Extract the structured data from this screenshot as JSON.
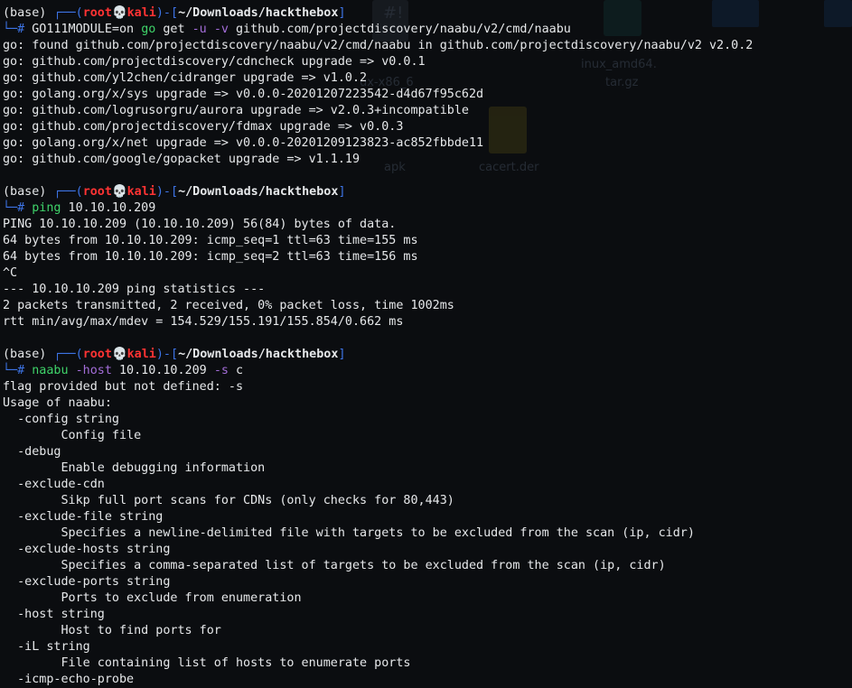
{
  "desktop": {
    "icons": [
      {
        "label": "#!",
        "kind": "script"
      },
      {
        "label": "inux_amd64.",
        "kind": "archive"
      },
      {
        "label": "tar.gz",
        "kind": "archive"
      },
      {
        "label": "ux-x86_6",
        "kind": "file"
      },
      {
        "label": "apk",
        "kind": "file"
      },
      {
        "label": "cacert.der",
        "kind": "certificate"
      }
    ]
  },
  "prompt": {
    "env": "(base)",
    "user": "root",
    "skull": "💀",
    "host": "kali",
    "cwd": "~/Downloads/hackthebox",
    "top_connector": "┌──(",
    "bottom_connector": "└─#",
    "mid_sep": ")-[",
    "close": "]"
  },
  "sessions": [
    {
      "command": {
        "pre": "GO111MODULE=on ",
        "bin": "go",
        "args": " get ",
        "flag1": "-u",
        "space": " ",
        "flag2": "-v",
        "rest": " github.com/projectdiscovery/naabu/v2/cmd/naabu"
      },
      "output": [
        "go: found github.com/projectdiscovery/naabu/v2/cmd/naabu in github.com/projectdiscovery/naabu/v2 v2.0.2",
        "go: github.com/projectdiscovery/cdncheck upgrade => v0.0.1",
        "go: github.com/yl2chen/cidranger upgrade => v1.0.2",
        "go: golang.org/x/sys upgrade => v0.0.0-20201207223542-d4d67f95c62d",
        "go: github.com/logrusorgru/aurora upgrade => v2.0.3+incompatible",
        "go: github.com/projectdiscovery/fdmax upgrade => v0.0.3",
        "go: golang.org/x/net upgrade => v0.0.0-20201209123823-ac852fbbde11",
        "go: github.com/google/gopacket upgrade => v1.1.19"
      ]
    },
    {
      "command": {
        "bin": "ping",
        "rest": " 10.10.10.209"
      },
      "output": [
        "PING 10.10.10.209 (10.10.10.209) 56(84) bytes of data.",
        "64 bytes from 10.10.10.209: icmp_seq=1 ttl=63 time=155 ms",
        "64 bytes from 10.10.10.209: icmp_seq=2 ttl=63 time=156 ms",
        "^C",
        "--- 10.10.10.209 ping statistics ---",
        "2 packets transmitted, 2 received, 0% packet loss, time 1002ms",
        "rtt min/avg/max/mdev = 154.529/155.191/155.854/0.662 ms"
      ]
    },
    {
      "command": {
        "bin": "naabu",
        "space1": " ",
        "flag1": "-host",
        "mid": " 10.10.10.209 ",
        "flag2": "-s",
        "rest": " c"
      },
      "output": [
        "flag provided but not defined: -s",
        "Usage of naabu:",
        "  -config string",
        "        Config file",
        "  -debug",
        "        Enable debugging information",
        "  -exclude-cdn",
        "        Sikp full port scans for CDNs (only checks for 80,443)",
        "  -exclude-file string",
        "        Specifies a newline-delimited file with targets to be excluded from the scan (ip, cidr)",
        "  -exclude-hosts string",
        "        Specifies a comma-separated list of targets to be excluded from the scan (ip, cidr)",
        "  -exclude-ports string",
        "        Ports to exclude from enumeration",
        "  -host string",
        "        Host to find ports for",
        "  -iL string",
        "        File containing list of hosts to enumerate ports",
        "  -icmp-echo-probe"
      ]
    }
  ],
  "colors": {
    "background": "#0b0d10",
    "prompt_frame": "#3d74e6",
    "user_host": "#ff3333",
    "command": "#3fd46a",
    "flag": "#a36dd8",
    "text": "#e6e8ea"
  }
}
